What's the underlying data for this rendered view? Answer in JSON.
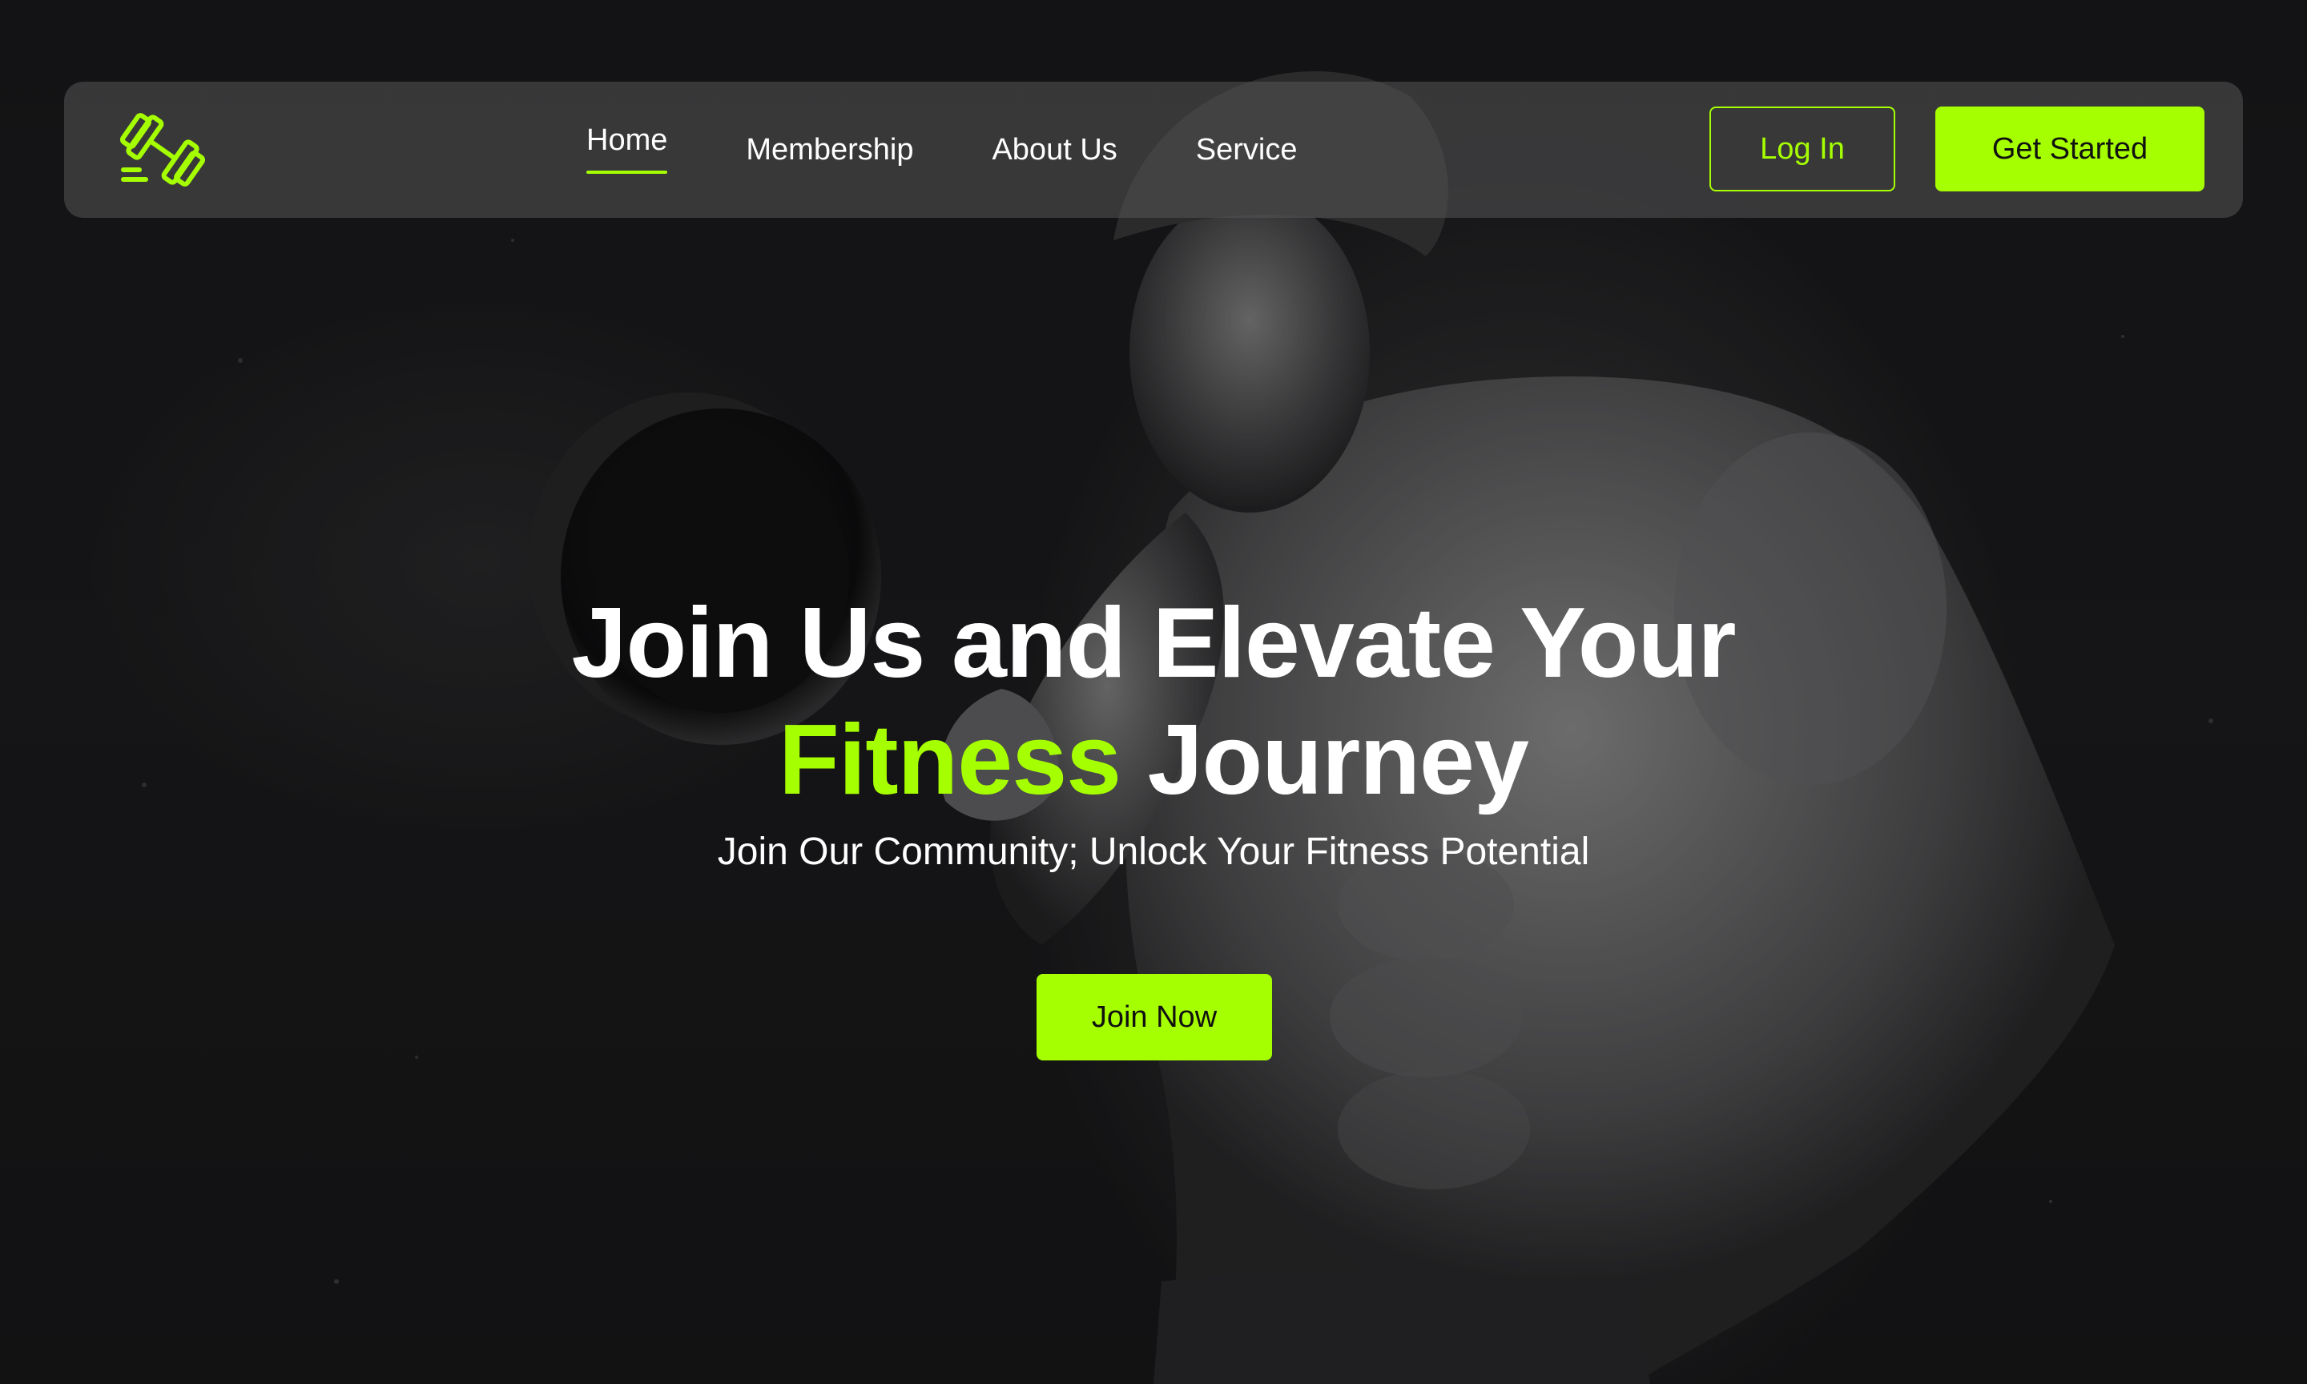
{
  "brand": {
    "logo_icon": "dumbbell-icon",
    "accent_color": "#a6ff00",
    "background_color": "#1b1b1e"
  },
  "nav": {
    "items": [
      {
        "label": "Home",
        "active": true
      },
      {
        "label": "Membership",
        "active": false
      },
      {
        "label": "About Us",
        "active": false
      },
      {
        "label": "Service",
        "active": false
      }
    ],
    "login_label": "Log In",
    "get_started_label": "Get Started"
  },
  "hero": {
    "title_line1": "Join Us and Elevate Your",
    "title_accent": "Fitness",
    "title_rest": "Journey",
    "subtitle": "Join Our Community; Unlock Your Fitness Potential",
    "cta_label": "Join Now"
  }
}
